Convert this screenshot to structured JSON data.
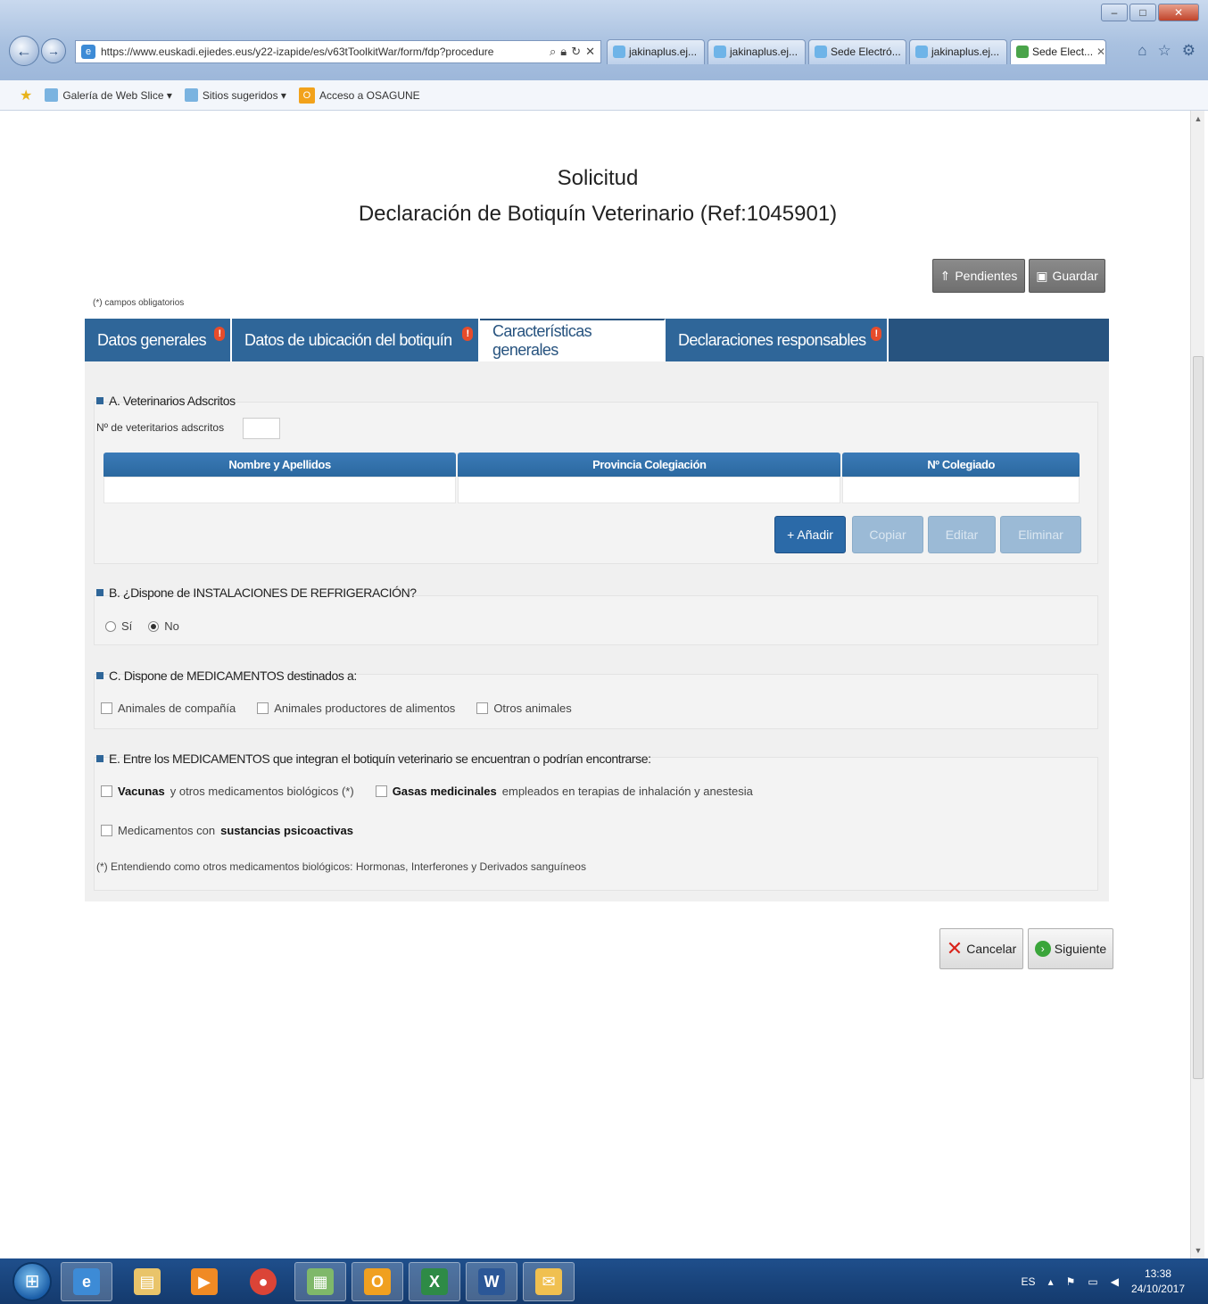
{
  "browser": {
    "url": "https://www.euskadi.ejiedes.eus/y22-izapide/es/v63tToolkitWar/form/fdp?procedure",
    "tabs": [
      {
        "label": "jakinaplus.ej..."
      },
      {
        "label": "jakinaplus.ej..."
      },
      {
        "label": "Sede Electró..."
      },
      {
        "label": "jakinaplus.ej..."
      },
      {
        "label": "Sede Elect..."
      }
    ],
    "favorites": {
      "slice_gallery": "Galería de Web Slice ▾",
      "suggested_sites": "Sitios sugeridos ▾",
      "osagune": "Acceso a OSAGUNE"
    }
  },
  "page": {
    "title": "Solicitud",
    "subtitle": "Declaración de Botiquín Veterinario (Ref:1045901)",
    "required_note": "(*) campos obligatorios",
    "actions": {
      "pending": "Pendientes",
      "save": "Guardar"
    },
    "form_tabs": [
      {
        "label": "Datos generales",
        "warning": "!"
      },
      {
        "label": "Datos de ubicación del botiquín",
        "warning": "!"
      },
      {
        "label": "Características generales",
        "warning": ""
      },
      {
        "label": "Declaraciones responsables",
        "warning": "!"
      }
    ],
    "section_a": {
      "title": "A. Veterinarios Adscritos",
      "vets_label": "Nº de veteritarios adscritos",
      "vets_value": "",
      "columns": [
        "Nombre y Apellidos",
        "Provincia Colegiación",
        "Nº Colegiado"
      ],
      "buttons": {
        "add": "+ Añadir",
        "copy": "Copiar",
        "edit": "Editar",
        "delete": "Eliminar"
      }
    },
    "section_b": {
      "title": "B. ¿Dispone de INSTALACIONES DE REFRIGERACIÓN?",
      "yes": "Sí",
      "no": "No",
      "selected": "No"
    },
    "section_c": {
      "title": "C. Dispone de MEDICAMENTOS destinados a:",
      "options": [
        "Animales de compañía",
        "Animales productores de alimentos",
        "Otros animales"
      ]
    },
    "section_e": {
      "title": "E. Entre los MEDICAMENTOS que integran el botiquín veterinario se encuentran o podrían encontrarse:",
      "vaccines_bold": "Vacunas",
      "vaccines_rest": "y otros medicamentos biológicos (*)",
      "gases_bold": "Gasas medicinales",
      "gases_rest": "empleados en terapias de inhalación y anestesia",
      "psycho_prefix": "Medicamentos con",
      "psycho_bold": "sustancias psicoactivas",
      "footnote": "(*) Entendiendo como otros medicamentos biológicos: Hormonas, Interferones y Derivados sanguíneos"
    },
    "bottom": {
      "cancel": "Cancelar",
      "next": "Siguiente"
    }
  },
  "taskbar": {
    "language": "ES",
    "time": "13:38",
    "date": "24/10/2017",
    "apps": [
      {
        "name": "internet-explorer",
        "color": "#3d8bd6",
        "glyph": "e"
      },
      {
        "name": "file-explorer",
        "color": "#e9c46a",
        "glyph": "▤"
      },
      {
        "name": "media-player",
        "color": "#f08a24",
        "glyph": "▶"
      },
      {
        "name": "chrome",
        "color": "#db4437",
        "glyph": "●"
      },
      {
        "name": "folders",
        "color": "#7fb86a",
        "glyph": "▦"
      },
      {
        "name": "outlook",
        "color": "#f0a020",
        "glyph": "O"
      },
      {
        "name": "excel",
        "color": "#2e8b46",
        "glyph": "X"
      },
      {
        "name": "word",
        "color": "#2b5797",
        "glyph": "W"
      },
      {
        "name": "mail",
        "color": "#f0c050",
        "glyph": "✉"
      }
    ]
  }
}
